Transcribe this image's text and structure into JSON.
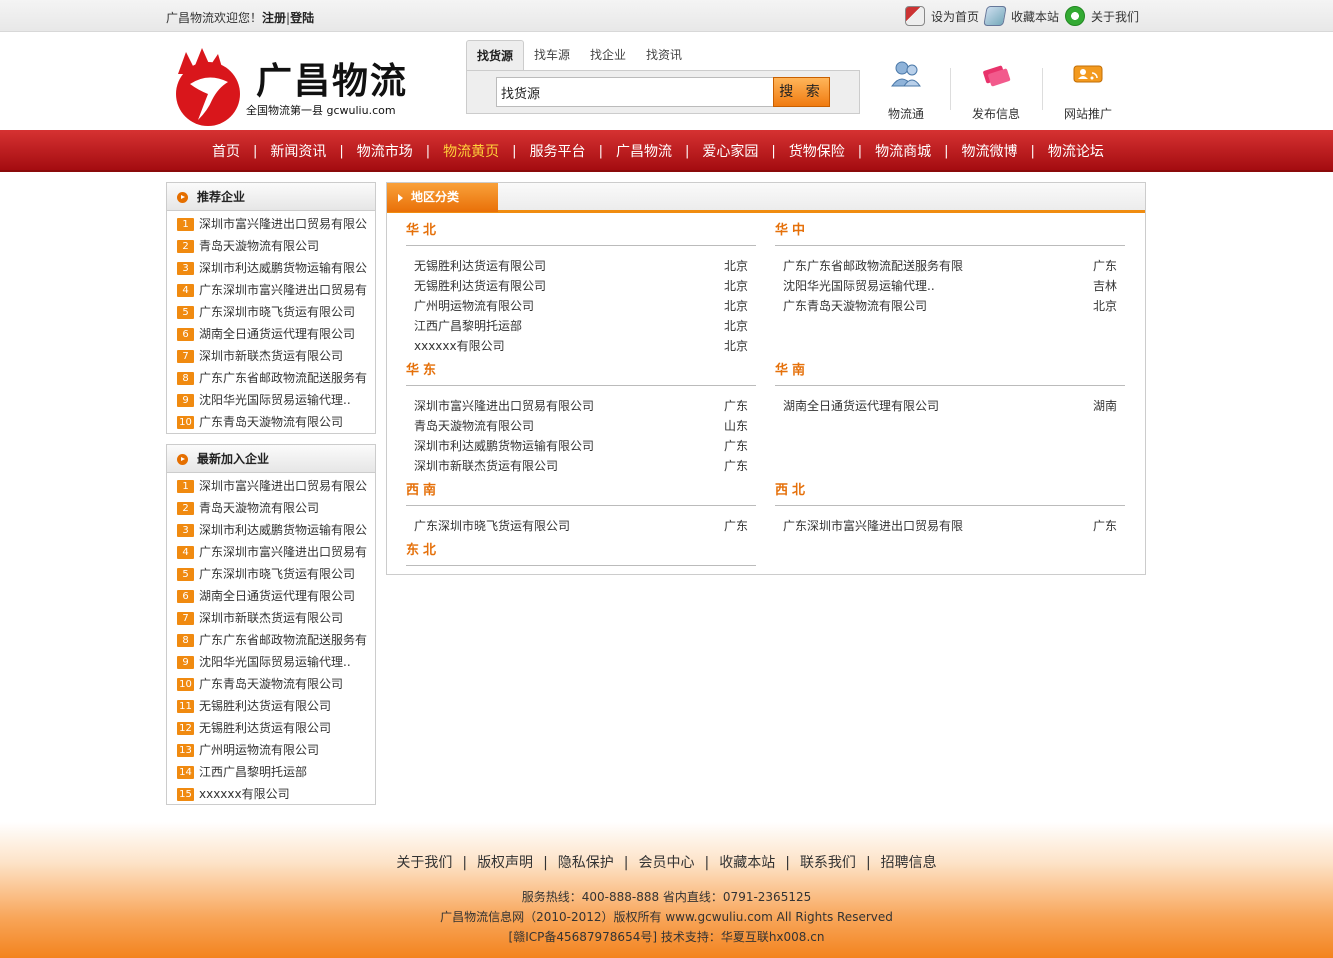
{
  "topbar": {
    "welcome": "广昌物流欢迎您！",
    "register": "注册",
    "divider": "|",
    "login": "登陆",
    "set_home": "设为首页",
    "bookmark": "收藏本站",
    "about": "关于我们"
  },
  "logo": {
    "name": "广昌物流",
    "slogan": "全国物流第一县 gcwuliu.com"
  },
  "search": {
    "tabs": [
      "找货源",
      "找车源",
      "找企业",
      "找资讯"
    ],
    "value": "找货源",
    "button": "搜 索"
  },
  "quick_links": [
    "物流通",
    "发布信息",
    "网站推广"
  ],
  "nav": {
    "items": [
      "首页",
      "新闻资讯",
      "物流市场",
      "物流黄页",
      "服务平台",
      "广昌物流",
      "爱心家园",
      "货物保险",
      "物流商城",
      "物流微博",
      "物流论坛"
    ],
    "current": "物流黄页",
    "separator": "|"
  },
  "recommended": {
    "title": "推荐企业",
    "items": [
      "深圳市富兴隆进出口贸易有限公",
      "青岛天漩物流有限公司",
      "深圳市利达威鹏货物运输有限公",
      "广东深圳市富兴隆进出口贸易有",
      "广东深圳市晓飞货运有限公司",
      "湖南全日通货运代理有限公司",
      "深圳市新联杰货运有限公司",
      "广东广东省邮政物流配送服务有",
      "沈阳华光国际贸易运输代理..",
      "广东青岛天漩物流有限公司"
    ]
  },
  "newest": {
    "title": "最新加入企业",
    "items": [
      "深圳市富兴隆进出口贸易有限公",
      "青岛天漩物流有限公司",
      "深圳市利达威鹏货物运输有限公",
      "广东深圳市富兴隆进出口贸易有",
      "广东深圳市晓飞货运有限公司",
      "湖南全日通货运代理有限公司",
      "深圳市新联杰货运有限公司",
      "广东广东省邮政物流配送服务有",
      "沈阳华光国际贸易运输代理..",
      "广东青岛天漩物流有限公司",
      "无锡胜利达货运有限公司",
      "无锡胜利达货运有限公司",
      "广州明运物流有限公司",
      "江西广昌黎明托运部",
      "xxxxxx有限公司"
    ]
  },
  "region": {
    "title": "地区分类",
    "groups": [
      {
        "name": "华北",
        "items": [
          {
            "company": "无锡胜利达货运有限公司",
            "place": "北京"
          },
          {
            "company": "无锡胜利达货运有限公司",
            "place": "北京"
          },
          {
            "company": "广州明运物流有限公司",
            "place": "北京"
          },
          {
            "company": "江西广昌黎明托运部",
            "place": "北京"
          },
          {
            "company": "xxxxxx有限公司",
            "place": "北京"
          }
        ]
      },
      {
        "name": "华中",
        "items": [
          {
            "company": "广东广东省邮政物流配送服务有限",
            "place": "广东"
          },
          {
            "company": "沈阳华光国际贸易运输代理..",
            "place": "吉林"
          },
          {
            "company": "广东青岛天漩物流有限公司",
            "place": "北京"
          }
        ]
      },
      {
        "name": "华东",
        "items": [
          {
            "company": "深圳市富兴隆进出口贸易有限公司",
            "place": "广东"
          },
          {
            "company": "青岛天漩物流有限公司",
            "place": "山东"
          },
          {
            "company": "深圳市利达威鹏货物运输有限公司",
            "place": "广东"
          },
          {
            "company": "深圳市新联杰货运有限公司",
            "place": "广东"
          }
        ]
      },
      {
        "name": "华南",
        "items": [
          {
            "company": "湖南全日通货运代理有限公司",
            "place": "湖南"
          }
        ]
      },
      {
        "name": "西南",
        "items": [
          {
            "company": "广东深圳市晓飞货运有限公司",
            "place": "广东"
          }
        ]
      },
      {
        "name": "西北",
        "items": [
          {
            "company": "广东深圳市富兴隆进出口贸易有限",
            "place": "广东"
          }
        ]
      },
      {
        "name": "东北",
        "items": []
      }
    ]
  },
  "footer": {
    "links": [
      "关于我们",
      "版权声明",
      "隐私保护",
      "会员中心",
      "收藏本站",
      "联系我们",
      "招聘信息"
    ],
    "separator": "|",
    "hotline": "服务热线：400-888-888 省内直线：0791-2365125",
    "copyright": "广昌物流信息网（2010-2012）版权所有 www.gcwuliu.com All Rights Reserved",
    "icp": "[赣ICP备45687978654号] 技术支持：华夏互联hx008.cn"
  },
  "colors": {
    "nav_red": "#c21a1e",
    "accent_orange": "#f08c10",
    "nav_current": "#ffd23a"
  }
}
